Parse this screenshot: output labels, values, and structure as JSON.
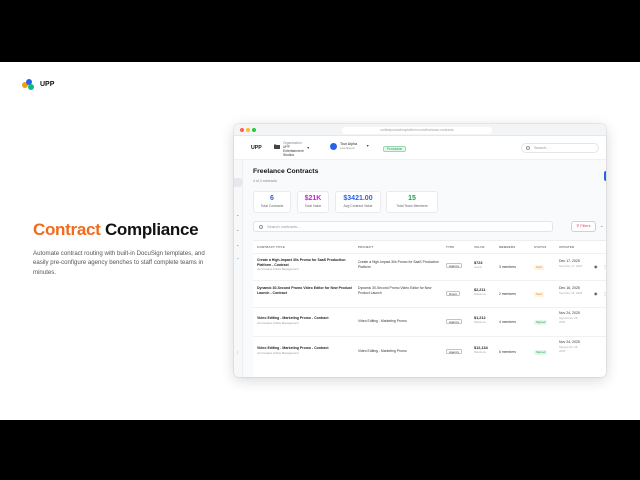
{
  "brand": {
    "name": "UPP"
  },
  "hero": {
    "title_accent": "Contract",
    "title_rest": "Compliance",
    "description": "Automate contract routing with built-in DocuSign templates, and easily pre-configure agency benches to staff complete teams in minutes."
  },
  "browser": {
    "url": "unifiedproductionplatform.com/freelance-contracts"
  },
  "topbar": {
    "brand": "UPP",
    "org_label": "Organization",
    "org_name_1": "UPP",
    "org_name_2": "Entertainment",
    "org_name_3": "Studios",
    "user_name": "Tour Alpha",
    "user_sub": "Live Event",
    "env_badge": "Production",
    "search_placeholder": "Search..."
  },
  "page": {
    "title": "Freelance Contracts",
    "subtitle": "4 of 4 contracts"
  },
  "stats": [
    {
      "value": "6",
      "label": "Total Contracts",
      "color": "#2563eb"
    },
    {
      "value": "$21K",
      "label": "Total Value",
      "color": "#c026d3"
    },
    {
      "value": "$3421.00",
      "label": "Avg Contract Value",
      "color": "#2563eb"
    },
    {
      "value": "15",
      "label": "Total Team Members",
      "color": "#16a34a"
    }
  ],
  "toolbar": {
    "search_placeholder": "Search contracts...",
    "filters_label": "Filters"
  },
  "table": {
    "headers": [
      "CONTRACT TITLE",
      "PROJECT",
      "TYPE",
      "VALUE",
      "MEMBERS",
      "STATUS",
      "UPDATED"
    ],
    "rows": [
      {
        "title": "Create a High-Impact 30s Promo for SaaS Production Platform - Contract",
        "agency": "via Creative Artists Management",
        "project": "Create a High-Impact 30s Promo for SaaS Production Platform",
        "type": "Agency",
        "value": "$723",
        "value_sub": "Hourly",
        "members": "3 members",
        "status": "Sent",
        "status_kind": "sent",
        "updated": "Dec 17, 2025",
        "updated_sub": "Sent Dec 17, 2025"
      },
      {
        "title": "Dynamic 30-Second Promo Video Editor for New Product Launch - Contract",
        "agency": "",
        "project": "Dynamic 30-Second Promo Video Editor for New Product Launch",
        "type": "Direct",
        "value": "$2,211",
        "value_sub": "Milestone",
        "members": "2 members",
        "status": "Sent",
        "status_kind": "sent",
        "updated": "Dec 16, 2025",
        "updated_sub": "Sent Dec 16, 2025"
      },
      {
        "title": "Video Editing - Marketing Promo - Contract",
        "agency": "via Creative Artists Management",
        "project": "Video Editing - Marketing Promo",
        "type": "Agency",
        "value": "$1,212",
        "value_sub": "Milestone",
        "members": "4 members",
        "status": "Signed",
        "status_kind": "signed",
        "updated": "Nov 24, 2025",
        "updated_sub": "Signed Nov 25, 2025"
      },
      {
        "title": "Video Editing - Marketing Promo - Contract",
        "agency": "via Creative Artists Management",
        "project": "Video Editing - Marketing Promo",
        "type": "Agency",
        "value": "$12,134",
        "value_sub": "Milestone",
        "members": "6 members",
        "status": "Signed",
        "status_kind": "signed",
        "updated": "Nov 24, 2025",
        "updated_sub": "Signed Nov 25, 2025"
      }
    ]
  },
  "icons": {
    "search": "search-icon",
    "eye": "eye-icon",
    "more": "more-icon",
    "chevron": "chevron-icon",
    "folder": "folder-icon",
    "filter": "filter-icon"
  },
  "colors": {
    "accent": "#ef6c1f",
    "primary": "#2563eb",
    "success": "#1f9d55",
    "warning": "#e08a1c"
  }
}
